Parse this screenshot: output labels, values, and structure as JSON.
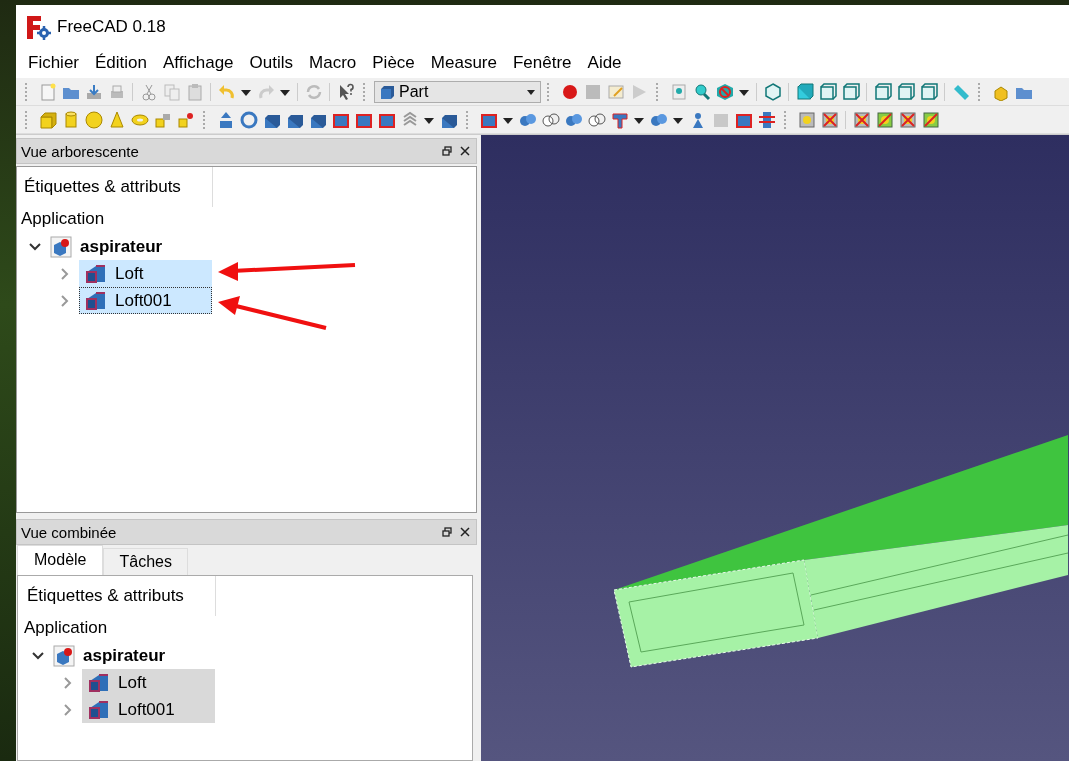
{
  "window": {
    "title": "FreeCAD 0.18"
  },
  "menu": [
    "Fichier",
    "Édition",
    "Affichage",
    "Outils",
    "Macro",
    "Pièce",
    "Measure",
    "Fenêtre",
    "Aide"
  ],
  "workbench_selector": {
    "value": "Part"
  },
  "tree_panel": {
    "title": "Vue arborescente",
    "tree": {
      "active": true,
      "column_header": "Étiquettes & attributs",
      "root_label": "Application",
      "documents": [
        {
          "label": "aspirateur",
          "expanded": true,
          "children": [
            {
              "label": "Loft",
              "expanded": false,
              "selected": true,
              "focused": false
            },
            {
              "label": "Loft001",
              "expanded": false,
              "selected": true,
              "focused": true
            }
          ]
        }
      ]
    }
  },
  "combo_panel": {
    "title": "Vue combinée",
    "tabs": [
      {
        "label": "Modèle",
        "selected": true
      },
      {
        "label": "Tâches",
        "selected": false
      }
    ],
    "tree": {
      "active": false,
      "column_header": "Étiquettes & attributs",
      "root_label": "Application",
      "documents": [
        {
          "label": "aspirateur",
          "expanded": true,
          "children": [
            {
              "label": "Loft",
              "expanded": false,
              "selected": true,
              "focused": false
            },
            {
              "label": "Loft001",
              "expanded": false,
              "selected": true,
              "focused": false
            }
          ]
        }
      ]
    }
  }
}
